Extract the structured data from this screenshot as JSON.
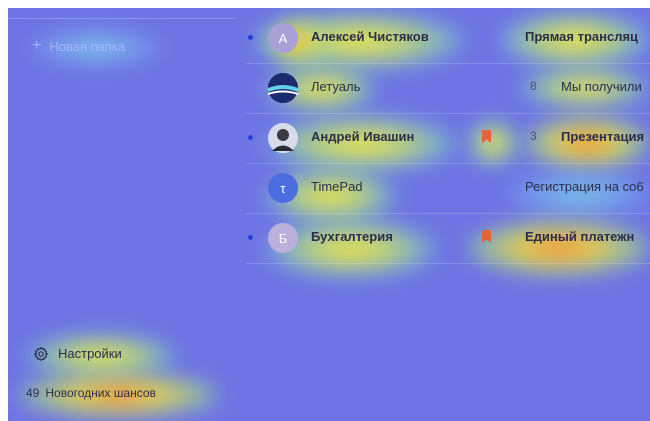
{
  "sidebar": {
    "new_folder_label": "Новая папка",
    "settings_label": "Настройки",
    "promo_count": "49",
    "promo_label": "Новогодних шансов"
  },
  "messages": [
    {
      "avatar_letter": "А",
      "sender": "Алексей Чистяков",
      "count": "",
      "subject": "Прямая трансляц",
      "unread": true,
      "bookmarked": false,
      "avatar_color": "#a9a0d6"
    },
    {
      "avatar_letter": "",
      "sender": "Летуаль",
      "count": "8",
      "subject": "Мы получили",
      "unread": false,
      "bookmarked": false,
      "avatar_color": "#1e2a70"
    },
    {
      "avatar_letter": "",
      "sender": "Андрей Ивашин",
      "count": "3",
      "subject": "Презентация",
      "unread": true,
      "bookmarked": true,
      "avatar_color": "#cfd6e6"
    },
    {
      "avatar_letter": "τ",
      "sender": "TimePad",
      "count": "",
      "subject": "Регистрация на co6",
      "unread": false,
      "bookmarked": false,
      "avatar_color": "#4b6de0"
    },
    {
      "avatar_letter": "Б",
      "sender": "Бухгалтерия",
      "count": "",
      "subject": "Единый платежн",
      "unread": true,
      "bookmarked": true,
      "avatar_color": "#b9b0dc"
    }
  ],
  "colors": {
    "background": "#6f74e4",
    "unread_dot": "#2b3dd9",
    "bookmark": "#e0663a",
    "text": "#2c2d4a"
  },
  "icons": {
    "new_folder": "plus-icon",
    "settings": "gear-icon",
    "bookmark": "bookmark-icon"
  }
}
